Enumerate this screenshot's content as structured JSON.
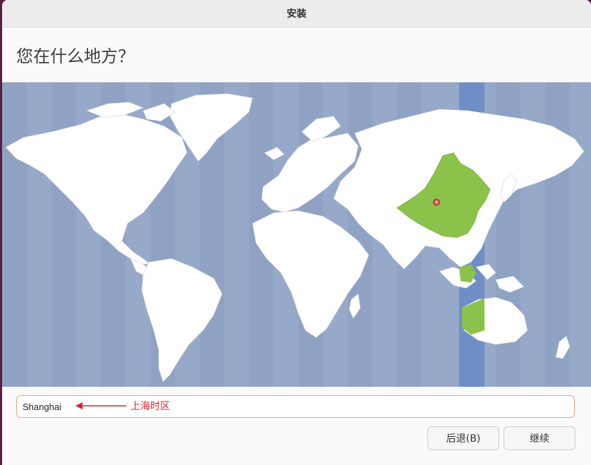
{
  "window": {
    "title": "安装"
  },
  "page": {
    "heading": "您在什么地方？"
  },
  "map": {
    "selected_timezone_region": "China",
    "selected_color": "#8bc34a",
    "ocean_color": "#97a9c8",
    "land_color": "#ffffff",
    "highlight_band_color": "#6f8ec6"
  },
  "timezone": {
    "value": "Shanghai"
  },
  "annotation": {
    "text": "上海时区"
  },
  "buttons": {
    "back": "后退(B)",
    "continue": "继续"
  }
}
